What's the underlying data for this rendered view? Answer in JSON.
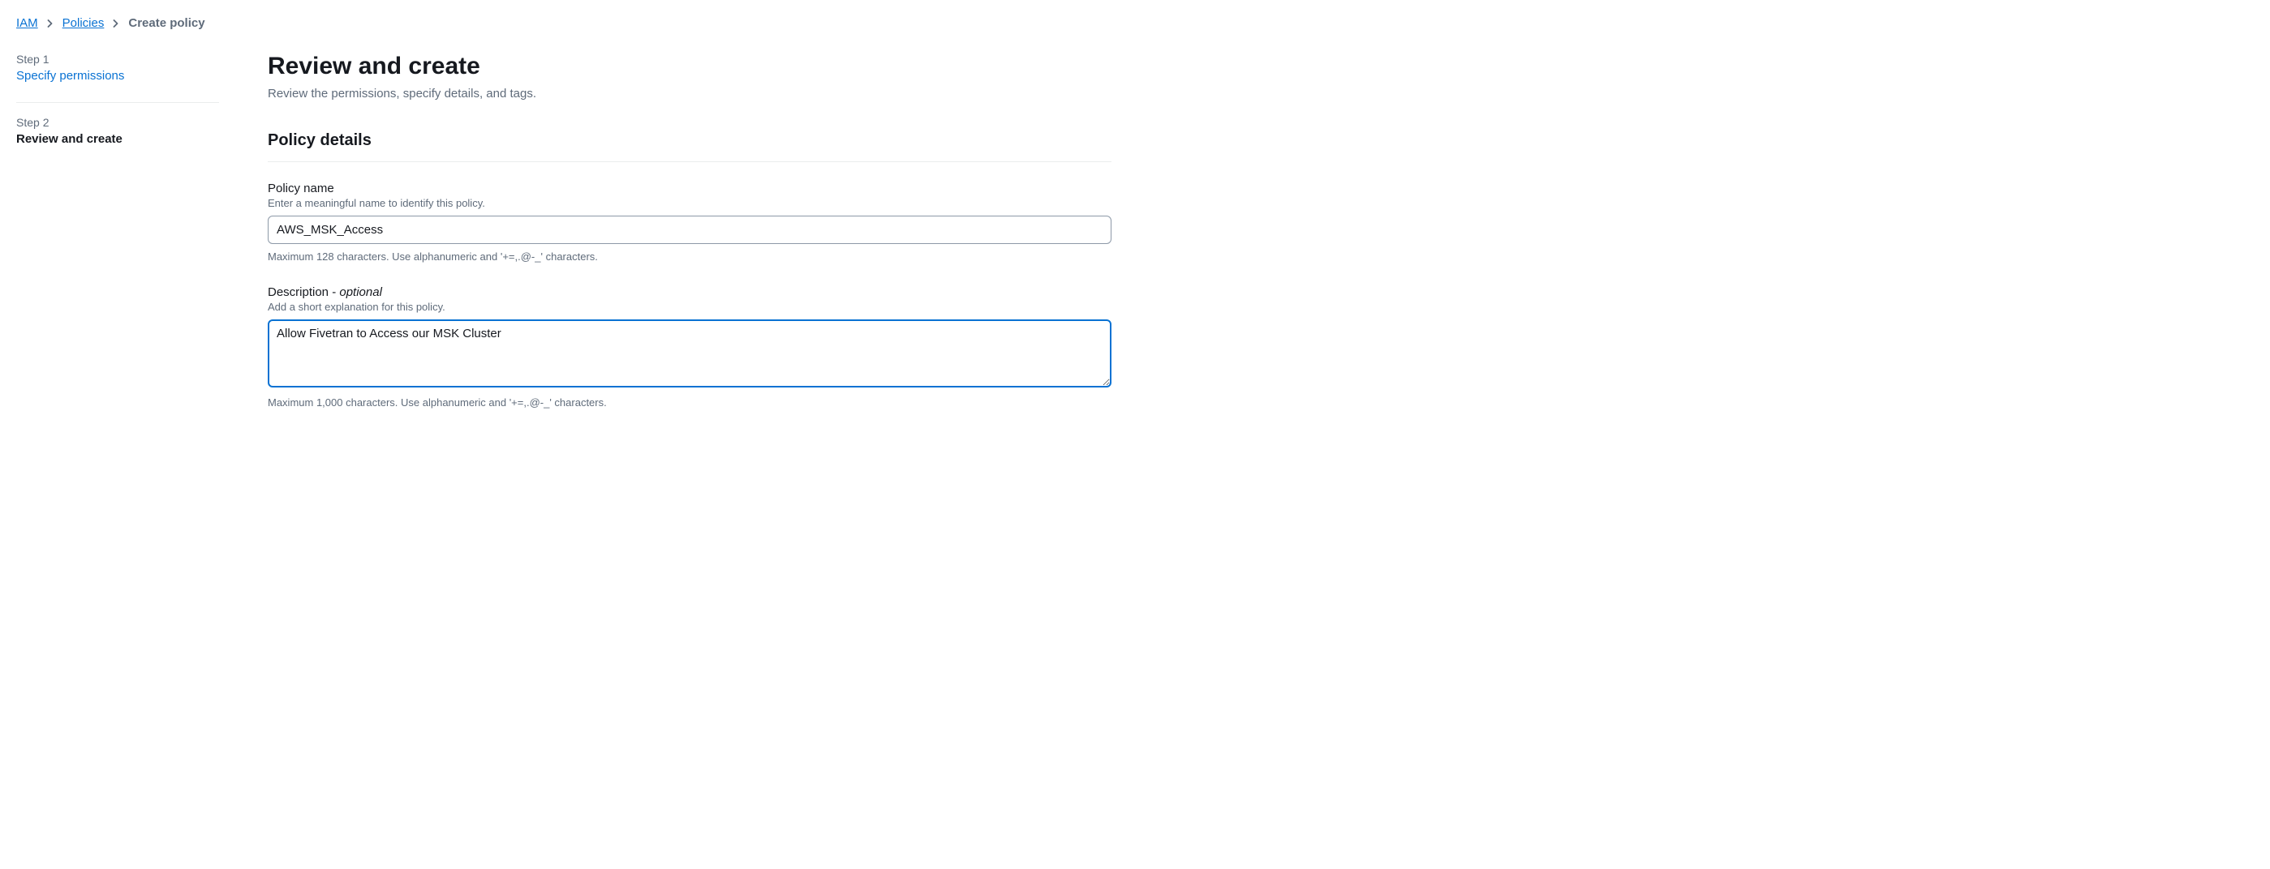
{
  "breadcrumbs": {
    "items": [
      {
        "label": "IAM"
      },
      {
        "label": "Policies"
      }
    ],
    "current": "Create policy"
  },
  "sidebar": {
    "step1": {
      "label": "Step 1",
      "title": "Specify permissions"
    },
    "step2": {
      "label": "Step 2",
      "title": "Review and create"
    }
  },
  "main": {
    "title": "Review and create",
    "subtitle": "Review the permissions, specify details, and tags.",
    "section_title": "Policy details",
    "policy_name": {
      "label": "Policy name",
      "help": "Enter a meaningful name to identify this policy.",
      "value": "AWS_MSK_Access",
      "hint": "Maximum 128 characters. Use alphanumeric and '+=,.@-_' characters."
    },
    "description": {
      "label": "Description - ",
      "optional": "optional",
      "help": "Add a short explanation for this policy.",
      "value": "Allow Fivetran to Access our MSK Cluster",
      "hint": "Maximum 1,000 characters. Use alphanumeric and '+=,.@-_' characters."
    }
  }
}
